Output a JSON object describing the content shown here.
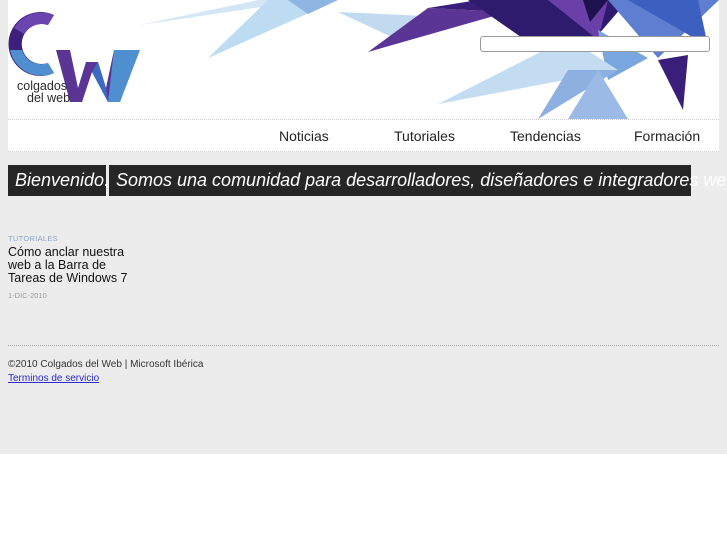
{
  "brand": {
    "logo_line1": "colgados",
    "logo_line2": "del web"
  },
  "search": {
    "value": "",
    "placeholder": ""
  },
  "nav": {
    "items": [
      {
        "label": "Noticias"
      },
      {
        "label": "Tutoriales"
      },
      {
        "label": "Tendencias"
      },
      {
        "label": "Formación"
      }
    ]
  },
  "welcome": {
    "greeting": "Bienvenido.",
    "tagline": "Somos una comunidad para desarrolladores, diseñadores e integradores web."
  },
  "post": {
    "category": "TUTORIALES",
    "title": "Cómo anclar nuestra web a la Barra de Tareas de Windows 7",
    "date": "1-DIC-2010"
  },
  "footer": {
    "copyright": "©2010 Colgados del Web | Microsoft Ibérica",
    "terms_link": "Terminos de servicio"
  },
  "colors": {
    "page_bg": "#ececec",
    "banner_bg": "#262626",
    "accent_purple": "#4a2a8a",
    "accent_blue": "#3f72c9",
    "light_blue": "#b5d3ee",
    "link": "#2a2ad0"
  }
}
